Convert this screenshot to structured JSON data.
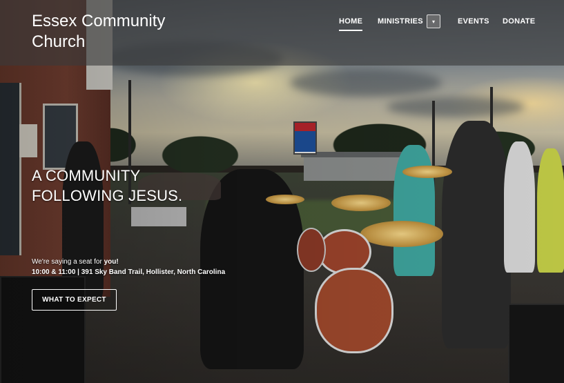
{
  "site": {
    "name": "Essex Community Church"
  },
  "nav": {
    "items": [
      {
        "label": "HOME",
        "active": true
      },
      {
        "label": "MINISTRIES",
        "active": false
      },
      {
        "label": "EVENTS",
        "active": false
      },
      {
        "label": "DONATE",
        "active": false
      }
    ],
    "dropdown_icon": "caret-down-icon"
  },
  "hero": {
    "headline": "A COMMUNITY FOLLOWING JESUS.",
    "tagline_prefix": "We're saying a seat for ",
    "tagline_emphasis": "you!",
    "details": "10:00 & 11:00 | 391 Sky Band Trail, Hollister, North Carolina",
    "cta_label": "WHAT TO EXPECT",
    "background_description_colors": {
      "overlay": "#3a3a3a",
      "text": "#ffffff"
    }
  }
}
